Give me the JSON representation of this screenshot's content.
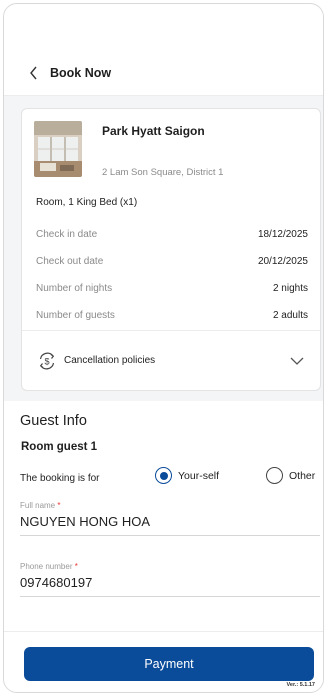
{
  "header": {
    "title": "Book Now",
    "back_icon": "chevron-left-icon"
  },
  "hotel": {
    "name": "Park Hyatt Saigon",
    "address": "2 Lam Son Square, District 1",
    "room": "Room, 1 King Bed (x1)",
    "details": [
      {
        "label": "Check in date",
        "value": "18/12/2025"
      },
      {
        "label": "Check out date",
        "value": "20/12/2025"
      },
      {
        "label": "Number of nights",
        "value": "2 nights"
      },
      {
        "label": "Number of guests",
        "value": "2 adults"
      }
    ],
    "cancellation_label": "Cancellation policies"
  },
  "guest": {
    "title": "Guest Info",
    "room_guest": "Room guest 1",
    "booking_for_label": "The booking is for",
    "options": [
      {
        "label": "Your-self",
        "selected": true
      },
      {
        "label": "Other",
        "selected": false
      }
    ],
    "full_name": {
      "label": "Full name",
      "required_mark": "*",
      "value": "NGUYEN HONG HOA"
    },
    "phone": {
      "label": "Phone number",
      "required_mark": "*",
      "value": "0974680197"
    }
  },
  "footer": {
    "payment_label": "Payment",
    "version": "Ver.: 5.1.17"
  },
  "colors": {
    "primary": "#0a4b9a",
    "required": "#e53935",
    "muted": "#8a8a8a"
  }
}
